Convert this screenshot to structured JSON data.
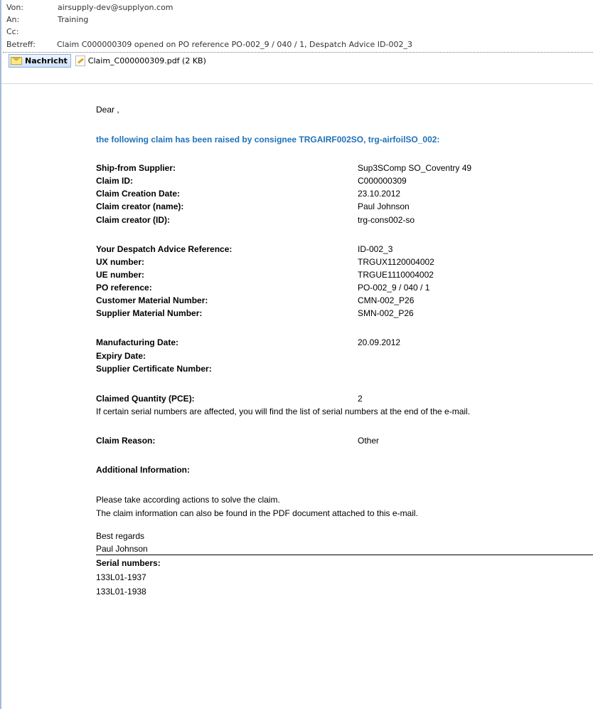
{
  "header": {
    "from_label": "Von:",
    "from_value": "airsupply-dev@supplyon.com",
    "to_label": "An:",
    "to_value": "Training",
    "cc_label": "Cc:",
    "subject_label": "Betreff:",
    "subject_value": "Claim C000000309 opened on PO reference PO-002_9 / 040 / 1, Despatch Advice ID-002_3",
    "message_tab": "Nachricht",
    "attachment": "Claim_C000000309.pdf (2 KB)"
  },
  "body": {
    "greeting": "Dear ,",
    "intro": "the following claim has been raised by consignee TRGAIRF002SO, trg-airfoilSO_002:",
    "group1": [
      {
        "label": "Ship-from Supplier:",
        "value": "Sup3SComp SO_Coventry 49"
      },
      {
        "label": "Claim ID:",
        "value": "C000000309"
      },
      {
        "label": "Claim Creation Date:",
        "value": "23.10.2012"
      },
      {
        "label": "Claim creator (name):",
        "value": "Paul Johnson"
      },
      {
        "label": "Claim creator (ID):",
        "value": "trg-cons002-so"
      }
    ],
    "group2": [
      {
        "label": "Your Despatch Advice Reference:",
        "value": "ID-002_3"
      },
      {
        "label": "UX number:",
        "value": "TRGUX1120004002"
      },
      {
        "label": "UE number:",
        "value": "TRGUE1110004002"
      },
      {
        "label": "PO reference:",
        "value": "PO-002_9 / 040 / 1"
      },
      {
        "label": "Customer Material Number:",
        "value": "CMN-002_P26"
      },
      {
        "label": "Supplier Material Number:",
        "value": "SMN-002_P26"
      }
    ],
    "group3": [
      {
        "label": "Manufacturing Date:",
        "value": "20.09.2012"
      },
      {
        "label": "Expiry Date:",
        "value": ""
      },
      {
        "label": "Supplier Certificate Number:",
        "value": ""
      }
    ],
    "claimed_qty_label": "Claimed Quantity (PCE):",
    "claimed_qty_value": "2",
    "serial_note": "If certain serial numbers are affected, you will find the list of serial numbers at the end of the e-mail.",
    "reason_label": "Claim Reason:",
    "reason_value": "Other",
    "additional_label": "Additional Information:",
    "action_line1": "Please take according actions to solve the claim.",
    "action_line2": "The claim information can also be found in the PDF document attached to this e-mail.",
    "regards": "Best regards",
    "signature": "Paul Johnson",
    "serials_label": "Serial numbers:",
    "serials": [
      "133L01-1937",
      "133L01-1938"
    ]
  }
}
